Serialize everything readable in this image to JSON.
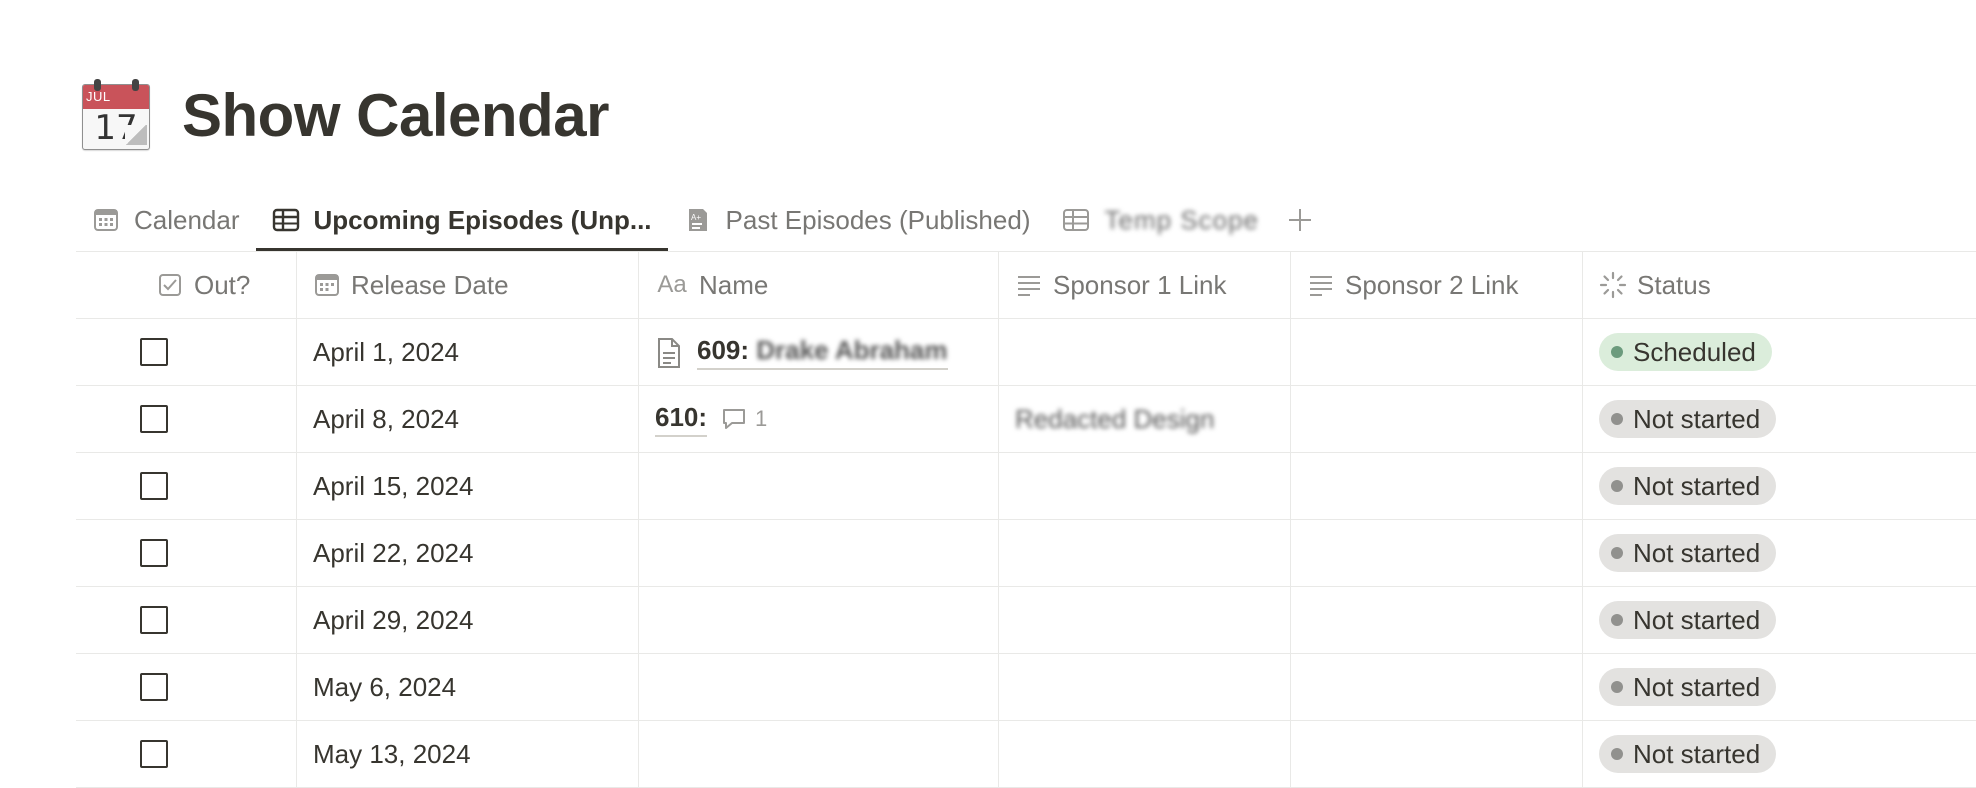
{
  "page": {
    "title": "Show Calendar",
    "emoji": {
      "name": "calendar-icon",
      "month": "JUL",
      "day": "17"
    }
  },
  "tabs": [
    {
      "label": "Calendar",
      "icon": "calendar-view-icon",
      "active": false
    },
    {
      "label": "Upcoming Episodes (Unp...",
      "icon": "table-view-icon",
      "active": true
    },
    {
      "label": "Past Episodes (Published)",
      "icon": "board-view-icon",
      "active": false
    },
    {
      "label": "Temp Scope",
      "icon": "table-view-icon",
      "active": false,
      "blurred": true
    }
  ],
  "columns": [
    {
      "label": "Out?",
      "icon": "checkbox-property-icon"
    },
    {
      "label": "Release Date",
      "icon": "date-property-icon"
    },
    {
      "label": "Name",
      "icon": "title-property-icon",
      "icon_text": "Aa"
    },
    {
      "label": "Sponsor 1 Link",
      "icon": "text-property-icon"
    },
    {
      "label": "Sponsor 2 Link",
      "icon": "text-property-icon"
    },
    {
      "label": "Status",
      "icon": "status-property-icon"
    }
  ],
  "rows": [
    {
      "out": false,
      "date": "April 1, 2024",
      "name": "609:",
      "name_hidden": "Drake Abraham",
      "has_doc_icon": true,
      "comments": "",
      "sponsor1": "",
      "sponsor2": "",
      "status": "Scheduled"
    },
    {
      "out": false,
      "date": "April 8, 2024",
      "name": "610:",
      "name_hidden": "",
      "has_doc_icon": false,
      "comments": "1",
      "sponsor1": "Redacted Design",
      "sponsor2": "",
      "status": "Not started"
    },
    {
      "out": false,
      "date": "April 15, 2024",
      "name": "",
      "sponsor1": "",
      "sponsor2": "",
      "status": "Not started"
    },
    {
      "out": false,
      "date": "April 22, 2024",
      "name": "",
      "sponsor1": "",
      "sponsor2": "",
      "status": "Not started"
    },
    {
      "out": false,
      "date": "April 29, 2024",
      "name": "",
      "sponsor1": "",
      "sponsor2": "",
      "status": "Not started"
    },
    {
      "out": false,
      "date": "May 6, 2024",
      "name": "",
      "sponsor1": "",
      "sponsor2": "",
      "status": "Not started"
    },
    {
      "out": false,
      "date": "May 13, 2024",
      "name": "",
      "sponsor1": "",
      "sponsor2": "",
      "status": "Not started"
    }
  ],
  "colors": {
    "scheduled_bg": "#dbeddb",
    "scheduled_dot": "#6c9b7d",
    "not_started_bg": "#e3e2e0",
    "not_started_dot": "#91918e",
    "text": "#37352f",
    "muted": "#787774"
  }
}
